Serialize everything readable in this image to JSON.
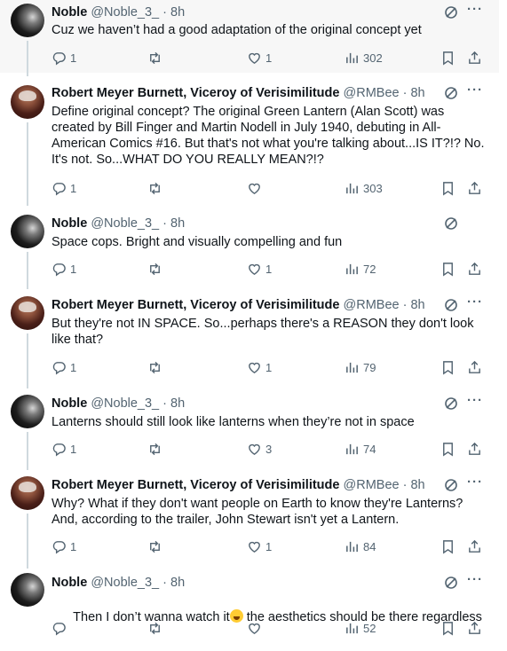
{
  "tweets": [
    {
      "author": "noble",
      "name": "Noble",
      "handle": "@Noble_3_",
      "sep": "·",
      "time": "8h",
      "text": "Cuz we haven’t had a good adaptation of the original concept yet",
      "replies": "1",
      "retweets": "",
      "likes": "1",
      "views": "302"
    },
    {
      "author": "rmb",
      "name": "Robert Meyer Burnett, Viceroy of Verisimilitude",
      "handle": "@RMBee",
      "sep": "·",
      "time": "8h",
      "text": "Define original concept? The original Green Lantern (Alan Scott) was\ncreated by Bill Finger and Martin Nodell in July 1940, debuting in All-\nAmerican Comics #16. But that's not what you're talking about...IS IT?!? No.\nIt's not. So...WHAT DO YOU REALLY MEAN?!?",
      "replies": "1",
      "retweets": "",
      "likes": "",
      "views": "303"
    },
    {
      "author": "noble",
      "name": "Noble",
      "handle": "@Noble_3_",
      "sep": "·",
      "time": "8h",
      "text": "Space cops. Bright and visually compelling and fun",
      "replies": "1",
      "retweets": "",
      "likes": "1",
      "views": "72"
    },
    {
      "author": "rmb",
      "name": "Robert Meyer Burnett, Viceroy of Verisimilitude",
      "handle": "@RMBee",
      "sep": "·",
      "time": "8h",
      "text": "But they're not IN SPACE. So...perhaps there's a REASON they don't look\nlike that?",
      "replies": "1",
      "retweets": "",
      "likes": "1",
      "views": "79"
    },
    {
      "author": "noble",
      "name": "Noble",
      "handle": "@Noble_3_",
      "sep": "·",
      "time": "8h",
      "text": "Lanterns should still look like lanterns when they’re not in space",
      "replies": "1",
      "retweets": "",
      "likes": "3",
      "views": "74"
    },
    {
      "author": "rmb",
      "name": "Robert Meyer Burnett, Viceroy of Verisimilitude",
      "handle": "@RMBee",
      "sep": "·",
      "time": "8h",
      "text": "Why? What if they don't want people on Earth to know they're Lanterns?\nAnd, according to the trailer, John Stewart isn't yet a Lantern.",
      "replies": "1",
      "retweets": "",
      "likes": "1",
      "views": "84"
    },
    {
      "author": "noble",
      "name": "Noble",
      "handle": "@Noble_3_",
      "sep": "·",
      "time": "8h",
      "text_before": "Then I don’t wanna watch it",
      "text_after": " the aesthetics should be there regardless",
      "emoji": "face-with-tears-of-joy-emoji",
      "replies": "",
      "retweets": "",
      "likes": "",
      "views": "52"
    }
  ],
  "more_label": "···",
  "icons": {
    "reply": "reply-icon",
    "retweet": "retweet-icon",
    "like": "heart-icon",
    "views": "views-chart-icon",
    "bookmark": "bookmark-icon",
    "share": "share-icon",
    "grok": "grok-icon"
  },
  "colors": {
    "text": "#0f1419",
    "muted": "#536471",
    "thread_line": "#cfd9de",
    "highlight_bg": "#f7f7f7"
  }
}
